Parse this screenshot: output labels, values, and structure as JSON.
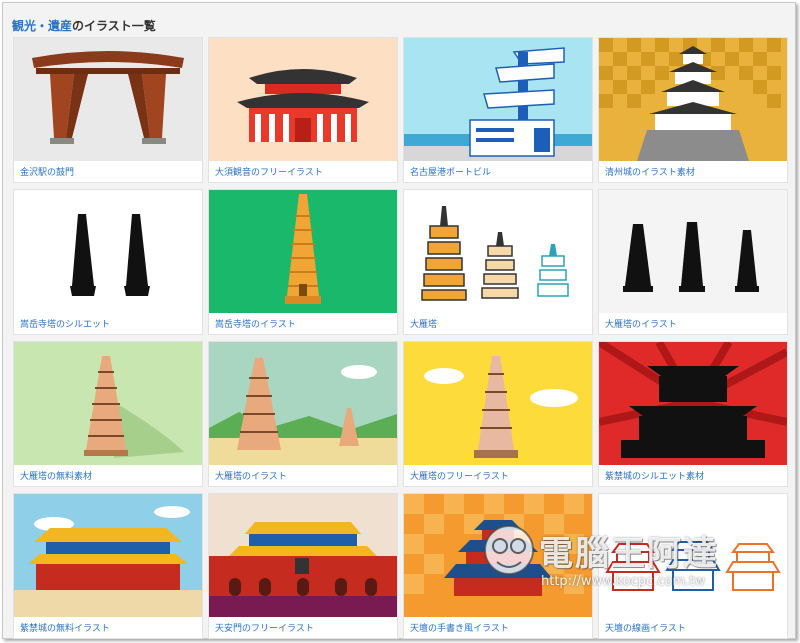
{
  "heading": {
    "link_text": "観光・遺産",
    "suffix_text": "のイラスト一覧"
  },
  "cards": [
    {
      "caption": "金沢駅の鼓門",
      "icon": "tsuzumimon-gate-icon"
    },
    {
      "caption": "大須観音のフリーイラスト",
      "icon": "osu-kannon-temple-icon"
    },
    {
      "caption": "名古屋港ポートビル",
      "icon": "port-building-icon"
    },
    {
      "caption": "清州城のイラスト素材",
      "icon": "kiyosu-castle-icon"
    },
    {
      "caption": "嵩岳寺塔のシルエット",
      "icon": "pagoda-silhouette-icon"
    },
    {
      "caption": "嵩岳寺塔のイラスト",
      "icon": "pagoda-icon"
    },
    {
      "caption": "大雁塔",
      "icon": "giant-wild-goose-pagoda-icon"
    },
    {
      "caption": "大雁塔のイラスト",
      "icon": "pagoda-silhouette-icon"
    },
    {
      "caption": "大雁塔の無料素材",
      "icon": "pagoda-icon"
    },
    {
      "caption": "大雁塔のイラスト",
      "icon": "pagoda-landscape-icon"
    },
    {
      "caption": "大雁塔のフリーイラスト",
      "icon": "pagoda-icon"
    },
    {
      "caption": "紫禁城のシルエット素材",
      "icon": "forbidden-city-silhouette-icon"
    },
    {
      "caption": "紫禁城の無料イラスト",
      "icon": "forbidden-city-icon"
    },
    {
      "caption": "天安門のフリーイラスト",
      "icon": "tiananmen-icon"
    },
    {
      "caption": "天壇の手書き風イラスト",
      "icon": "temple-of-heaven-icon"
    },
    {
      "caption": "天壇の線画イラスト",
      "icon": "temple-of-heaven-lineart-icon"
    }
  ],
  "watermark": {
    "text": "電腦王阿達",
    "url": "http://www.kocpc.com.tw"
  }
}
